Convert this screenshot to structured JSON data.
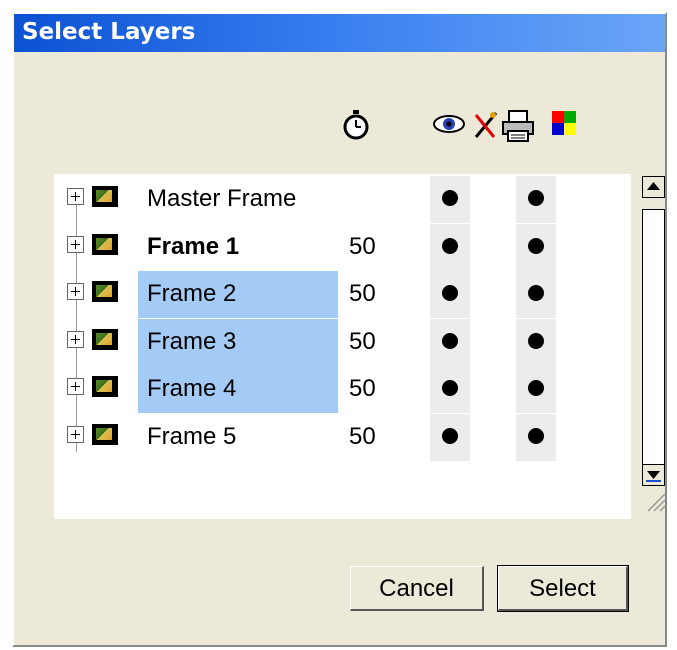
{
  "dialog": {
    "title": "Select Layers",
    "header_icons": [
      "stopwatch-icon",
      "eye-icon",
      "lock-icon",
      "printer-icon",
      "color-icon"
    ]
  },
  "layers": [
    {
      "name": "Master Frame",
      "value": "",
      "bold": false,
      "selected": false
    },
    {
      "name": "Frame 1",
      "value": "50",
      "bold": true,
      "selected": false
    },
    {
      "name": "Frame 2",
      "value": "50",
      "bold": false,
      "selected": true
    },
    {
      "name": "Frame 3",
      "value": "50",
      "bold": false,
      "selected": true
    },
    {
      "name": "Frame 4",
      "value": "50",
      "bold": false,
      "selected": true
    },
    {
      "name": "Frame 5",
      "value": "50",
      "bold": false,
      "selected": false
    }
  ],
  "buttons": {
    "cancel": "Cancel",
    "select": "Select"
  },
  "colors": {
    "title_bar": "#0b52d4",
    "selection": "#a4cbf6",
    "dialog_bg": "#ece9d8"
  }
}
